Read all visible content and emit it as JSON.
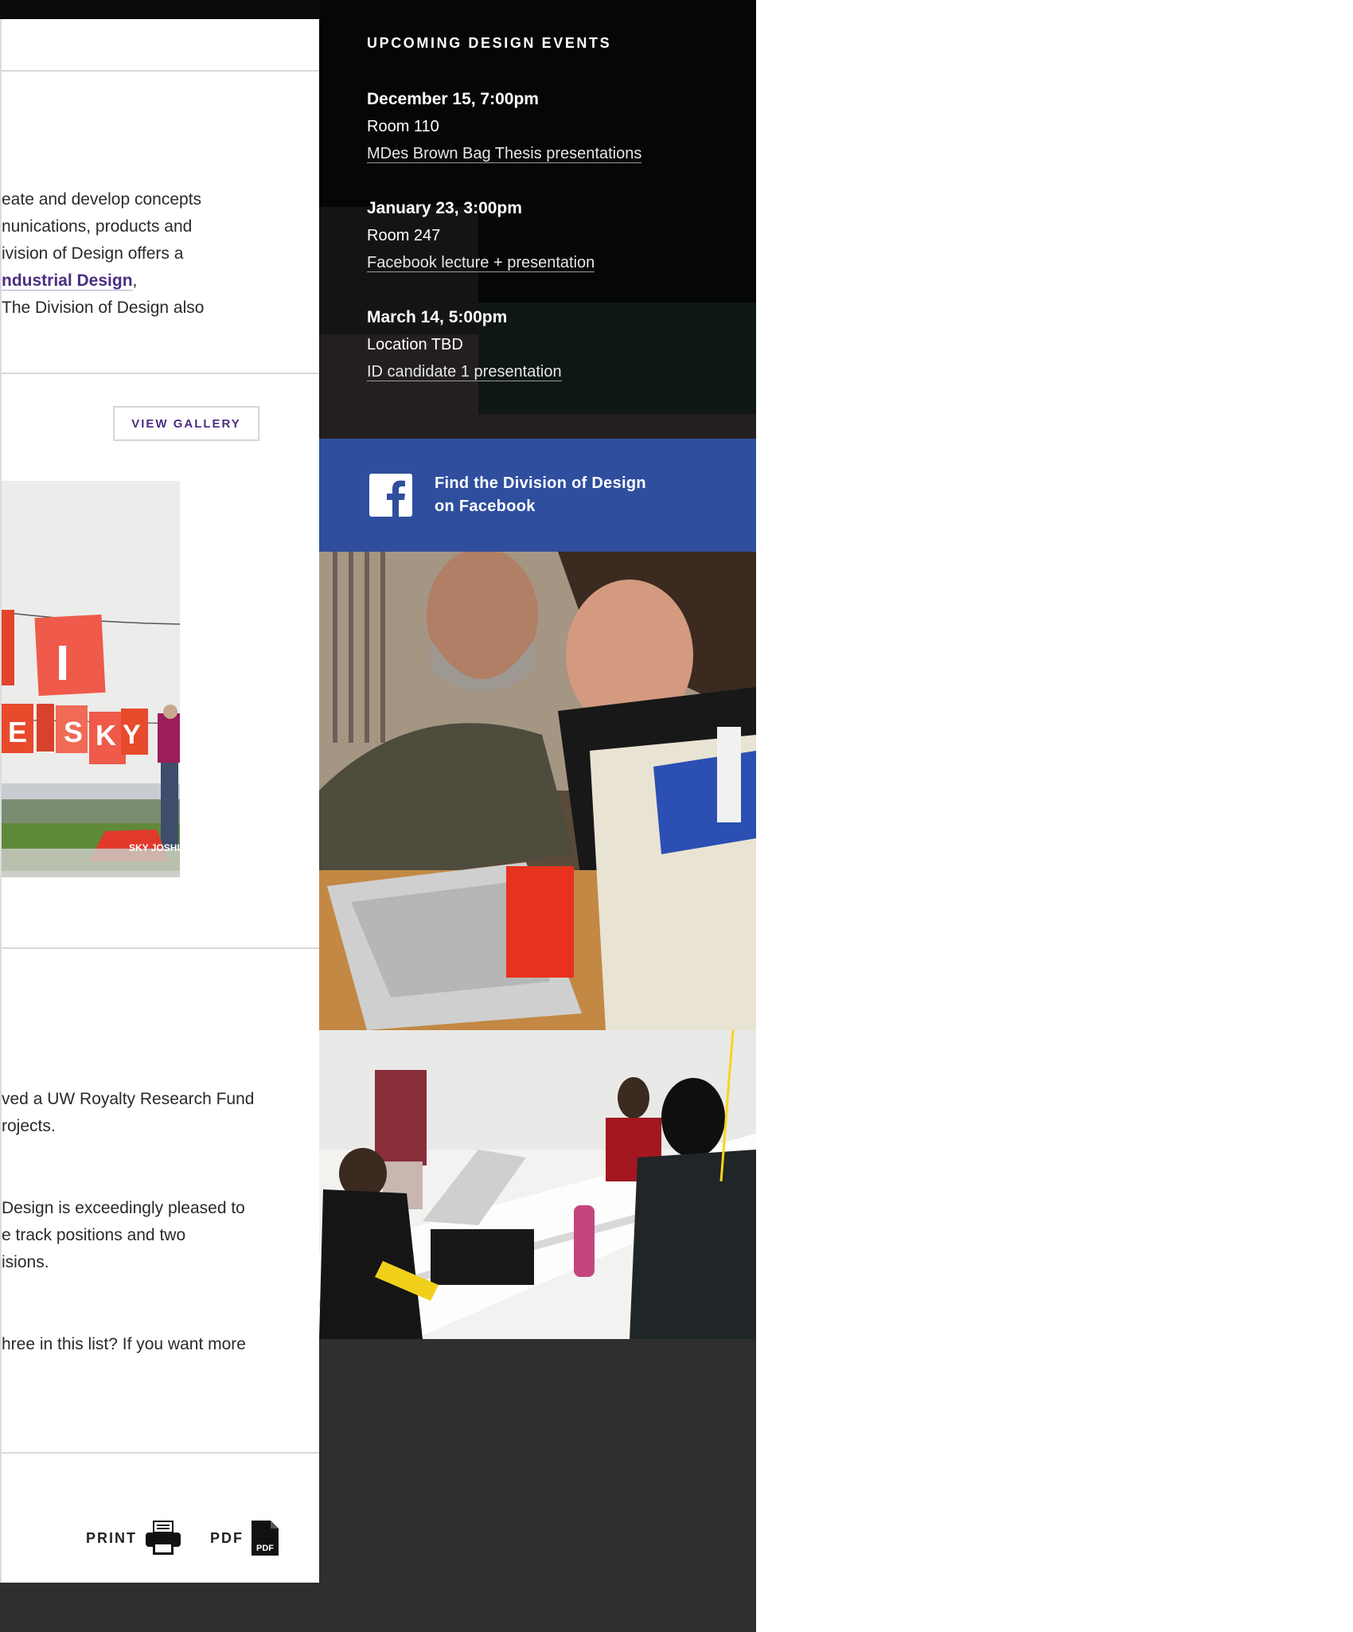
{
  "main": {
    "intro_lines": [
      "eate and develop concepts",
      "nunications, products and",
      "ivision of Design offers a",
      "ndustrial Design",
      " The Division of Design also"
    ],
    "intro_link_suffix": ",",
    "gallery": {
      "button_label": "VIEW GALLERY",
      "image_caption": "SKY JOSHUA RADIN",
      "image_letters": [
        "I",
        "E",
        "S",
        "K",
        "Y"
      ]
    },
    "news_1": [
      "ved a UW Royalty Research Fund",
      "rojects."
    ],
    "news_2": [
      "Design is exceedingly pleased to",
      "e track positions and two",
      "isions."
    ],
    "news_3": [
      "hree in this list? If you want more"
    ],
    "tools": {
      "print_label": "PRINT",
      "pdf_label": "PDF",
      "pdf_icon_text": "PDF"
    }
  },
  "events": {
    "title": "UPCOMING DESIGN EVENTS",
    "items": [
      {
        "date": "December 15, 7:00pm",
        "room": "Room 110",
        "link": "MDes Brown Bag Thesis presentations"
      },
      {
        "date": "January 23, 3:00pm",
        "room": "Room 247",
        "link": "Facebook lecture + presentation"
      },
      {
        "date": "March 14, 5:00pm",
        "room": "Location TBD",
        "link": "ID candidate 1 presentation"
      }
    ]
  },
  "facebook": {
    "line1": "Find the Division of Design",
    "line2": "on Facebook"
  },
  "colors": {
    "accent_purple": "#4b2e83",
    "facebook_blue": "#2f4f9e",
    "events_bg": "#231f20",
    "footer_bg": "#2f2f2f"
  },
  "icons": [
    "printer-icon",
    "pdf-file-icon",
    "facebook-icon"
  ]
}
